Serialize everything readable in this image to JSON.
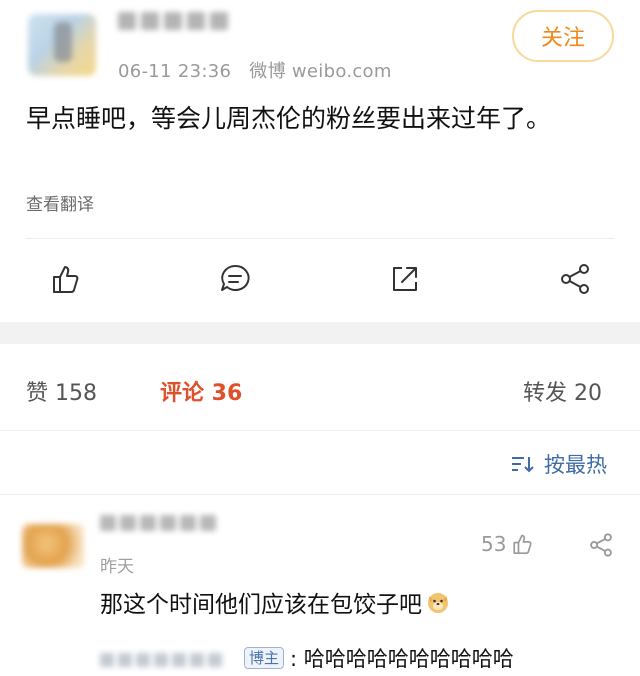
{
  "post": {
    "author": {
      "name": "广播电台"
    },
    "time": "06-11 23:36",
    "source": "微博 weibo.com",
    "follow_label": "关注",
    "text": "早点睡吧，等会儿周杰伦的粉丝要出来过年了。",
    "translate_label": "查看翻译",
    "actions": [
      "like-icon",
      "comment-icon",
      "repost-icon",
      "share-icon"
    ]
  },
  "stats": {
    "likes": "赞 158",
    "comments": "评论 36",
    "reposts": "转发 20"
  },
  "sort": {
    "label": "按最热"
  },
  "comment": {
    "username": "用户昵称",
    "time": "昨天",
    "likes": "53",
    "text": "那这个时间他们应该在包饺子吧",
    "emoji": "doge-icon",
    "reply": {
      "user": "回复用户",
      "badge": "博主",
      "text": ": 哈哈哈哈哈哈哈哈哈哈"
    }
  },
  "colors": {
    "accent": "#f08a1d",
    "comment_red": "#e0502b",
    "link_blue": "#3f6ca7"
  }
}
